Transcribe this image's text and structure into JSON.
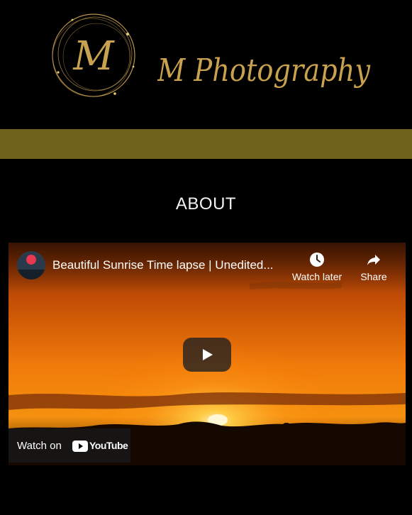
{
  "header": {
    "logo_monogram": "M",
    "logo_text": "M Photography"
  },
  "main": {
    "section_title": "ABOUT"
  },
  "video": {
    "title": "Beautiful Sunrise Time lapse | Unedited...",
    "watch_later_label": "Watch later",
    "share_label": "Share",
    "watch_on_label": "Watch on",
    "youtube_label": "YouTube"
  },
  "colors": {
    "background": "#000000",
    "nav_bar": "#6f621c",
    "logo_gold": "#c9a24f"
  },
  "icons": [
    "logo-monogram",
    "clock-icon",
    "share-arrow-icon",
    "play-icon",
    "youtube-icon"
  ]
}
